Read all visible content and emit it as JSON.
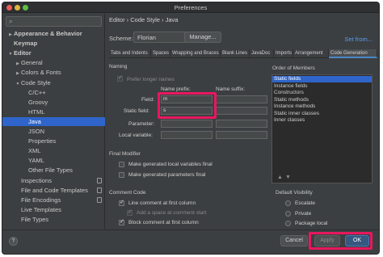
{
  "window": {
    "title": "Preferences"
  },
  "sidebar": {
    "search_placeholder": "",
    "items": [
      {
        "label": "Appearance & Behavior",
        "arrow": "▶",
        "bold": true
      },
      {
        "label": "Keymap",
        "arrow": "",
        "bold": true
      },
      {
        "label": "Editor",
        "arrow": "▼",
        "bold": true
      },
      {
        "label": "General",
        "arrow": "▶"
      },
      {
        "label": "Colors & Fonts",
        "arrow": "▶"
      },
      {
        "label": "Code Style",
        "arrow": "▼"
      },
      {
        "label": "C/C++",
        "arrow": ""
      },
      {
        "label": "Groovy",
        "arrow": ""
      },
      {
        "label": "HTML",
        "arrow": ""
      },
      {
        "label": "Java",
        "arrow": "",
        "selected": true
      },
      {
        "label": "JSON",
        "arrow": ""
      },
      {
        "label": "Properties",
        "arrow": ""
      },
      {
        "label": "XML",
        "arrow": ""
      },
      {
        "label": "YAML",
        "arrow": ""
      },
      {
        "label": "Other File Types",
        "arrow": ""
      },
      {
        "label": "Inspections",
        "arrow": ""
      },
      {
        "label": "File and Code Templates",
        "arrow": ""
      },
      {
        "label": "File Encodings",
        "arrow": ""
      },
      {
        "label": "Live Templates",
        "arrow": ""
      },
      {
        "label": "File Types",
        "arrow": ""
      }
    ]
  },
  "main": {
    "breadcrumb": "Editor › Code Style › Java",
    "scheme_label": "Scheme:",
    "scheme_value": "Florian",
    "manage_label": "Manage...",
    "set_from_label": "Set from...",
    "tabs": [
      "Tabs and Indents",
      "Spaces",
      "Wrapping and Braces",
      "Blank Lines",
      "JavaDoc",
      "Imports",
      "Arrangement",
      "Code Generation"
    ],
    "active_tab": 7,
    "naming": {
      "title": "Naming",
      "prefer_longer": "Prefer longer names",
      "prefix_header": "Name prefix:",
      "suffix_header": "Name suffix:",
      "rows": [
        {
          "label": "Field:",
          "prefix": "m",
          "suffix": ""
        },
        {
          "label": "Static field:",
          "prefix": "s",
          "suffix": ""
        },
        {
          "label": "Parameter:",
          "prefix": "",
          "suffix": ""
        },
        {
          "label": "Local variable:",
          "prefix": "",
          "suffix": ""
        }
      ]
    },
    "order": {
      "title": "Order of Members",
      "items": [
        "Static fields",
        "Instance fields",
        "Constructors",
        "Static methods",
        "Instance methods",
        "Static inner classes",
        "Inner classes"
      ],
      "controls": [
        "▲",
        "▼"
      ]
    },
    "final_modifier": {
      "title": "Final Modifier",
      "local_vars": "Make generated local variables final",
      "params": "Make generated parameters final"
    },
    "comment_code": {
      "title": "Comment Code",
      "line_first": "Line comment at first column",
      "add_space": "Add a space at comment start",
      "block_first": "Block comment at first column"
    },
    "default_visibility": {
      "title": "Default Visibility",
      "options": [
        "Escalate",
        "Private",
        "Package local"
      ]
    }
  },
  "footer": {
    "help": "?",
    "cancel": "Cancel",
    "apply": "Apply",
    "ok": "OK"
  },
  "colors": {
    "selection": "#2f65ca",
    "highlight": "#e8175d",
    "link": "#589df6"
  }
}
